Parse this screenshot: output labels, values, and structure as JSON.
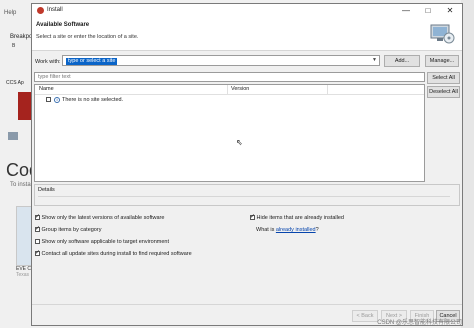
{
  "background": {
    "menu_help": "Help",
    "breakpoint_label": "Breakpo",
    "breakpoint_sub": "B",
    "ccs_label": "CCS Ap",
    "code_title": "Code",
    "to_install": "To instal",
    "eve_label": "EVE C",
    "eve_sub": "Texas"
  },
  "dialog": {
    "title": "Install",
    "window_controls": {
      "minimize": "—",
      "maximize": "□",
      "close": "✕"
    },
    "header_title": "Available Software",
    "header_subtitle": "Select a site or enter the location of a site.",
    "work_with_label": "Work with:",
    "work_with_value": "type or select a site",
    "add_button": "Add...",
    "manage_button": "Manage...",
    "filter_placeholder": "type filter text",
    "select_all_button": "Select All",
    "deselect_all_button": "Deselect All",
    "table": {
      "columns": [
        "Name",
        "Version"
      ],
      "rows": [
        {
          "name": "There is no site selected.",
          "version": ""
        }
      ]
    },
    "details_label": "Details",
    "options_left": [
      {
        "label": "Show only the latest versions of available software",
        "checked": true
      },
      {
        "label": "Group items by category",
        "checked": true
      },
      {
        "label": "Show only software applicable to target environment",
        "checked": false
      },
      {
        "label": "Contact all update sites during install to find required software",
        "checked": true
      }
    ],
    "options_right": [
      {
        "label": "Hide items that are already installed",
        "checked": true
      }
    ],
    "what_is_prefix": "What is",
    "what_is_link": "already installed",
    "what_is_suffix": "?",
    "footer_buttons": {
      "back": "< Back",
      "next": "Next >",
      "finish": "Finish",
      "cancel": "Cancel"
    }
  },
  "watermark": "CSDN @乐思智能科技有限公司",
  "colors": {
    "accent": "#0a64c8",
    "link": "#0645ad"
  }
}
